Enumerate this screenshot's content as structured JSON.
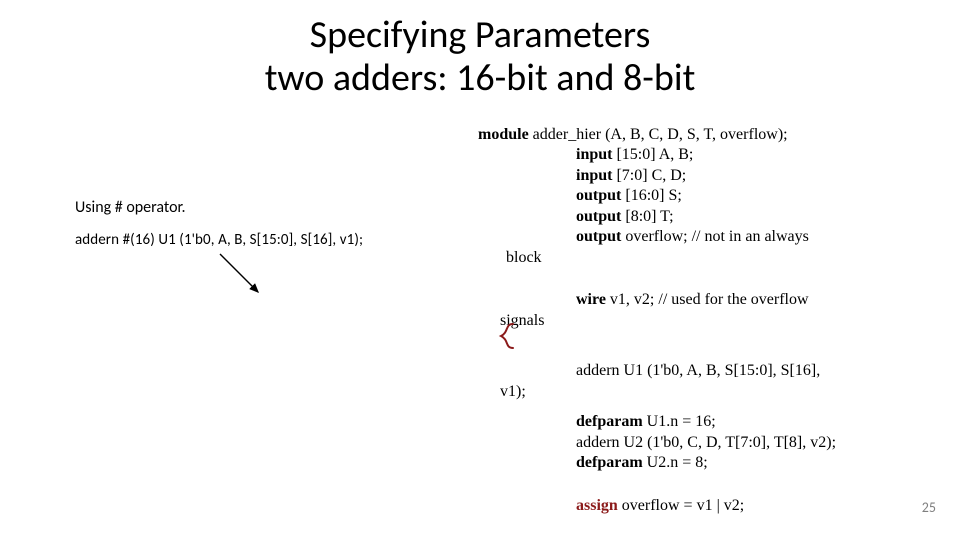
{
  "title_line1": "Specifying Parameters",
  "title_line2": "two adders: 16-bit and 8-bit",
  "left": {
    "using": "Using # operator.",
    "inst": "addern #(16) U1 (1'b0, A, B, S[15:0], S[16], v1);"
  },
  "right": {
    "mod_kw": "module",
    "mod_sig": " adder_hier (A, B, C, D, S, T, overflow);",
    "in1_kw": "input",
    "in1_rest": " [15:0] A, B;",
    "in2_kw": "input",
    "in2_rest": " [7:0] C, D;",
    "out1_kw": "output",
    "out1_rest": " [16:0] S;",
    "out2_kw": "output",
    "out2_rest": " [8:0] T;",
    "out3_kw": "output",
    "out3_rest": " overflow; // not in an always",
    "block": "block",
    "wire_kw": "wire",
    "wire_rest": " v1, v2;  // used for the overflow",
    "signals": "signals",
    "inst1": "addern U1 (1'b0, A, B, S[15:0], S[16],",
    "inst1_tail": "v1);",
    "defp1_kw": "defparam",
    "defp1_rest": " U1.n = 16;",
    "inst2": "addern U2 (1'b0, C, D, T[7:0], T[8], v2);",
    "defp2_kw": "defparam",
    "defp2_rest": " U2.n = 8;",
    "assign_kw": "assign",
    "assign_rest": " overflow = v1 | v2;"
  },
  "pagenum": "25"
}
